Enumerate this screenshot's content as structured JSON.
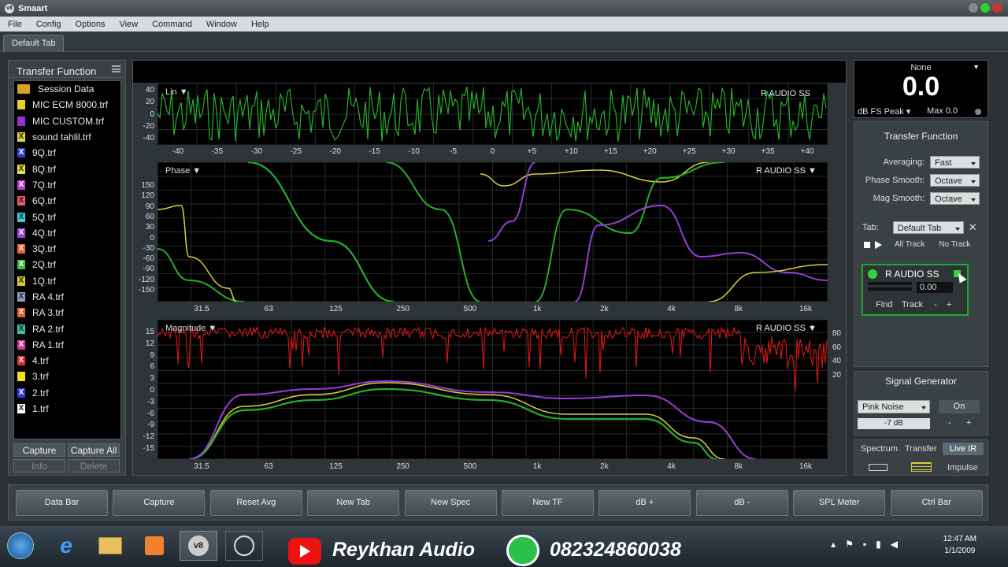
{
  "app": {
    "title": "Smaart",
    "logo": "v8"
  },
  "menu": [
    "File",
    "Config",
    "Options",
    "View",
    "Command",
    "Window",
    "Help"
  ],
  "tab": "Default Tab",
  "left_panel": {
    "title": "Transfer Function",
    "session": "Session Data",
    "files": [
      {
        "name": "MIC ECM 8000.trf",
        "color": "#e6d21c",
        "mark": ""
      },
      {
        "name": "MIC CUSTOM.trf",
        "color": "#9b2fd6",
        "mark": ""
      },
      {
        "name": "sound tahlil.trf",
        "color": "#dfd43a",
        "mark": "X"
      },
      {
        "name": "9Q.trf",
        "color": "#2c3fd8",
        "mark": "X"
      },
      {
        "name": "8Q.trf",
        "color": "#e8e03a",
        "mark": "X"
      },
      {
        "name": "7Q.trf",
        "color": "#c03ad8",
        "mark": "X"
      },
      {
        "name": "6Q.trf",
        "color": "#e85a6a",
        "mark": "X"
      },
      {
        "name": "5Q.trf",
        "color": "#3ad0d8",
        "mark": "X"
      },
      {
        "name": "4Q.trf",
        "color": "#a040e0",
        "mark": "X"
      },
      {
        "name": "3Q.trf",
        "color": "#e8602a",
        "mark": "X"
      },
      {
        "name": "2Q.trf",
        "color": "#3ac040",
        "mark": "X"
      },
      {
        "name": "1Q.trf",
        "color": "#d8d020",
        "mark": "X"
      },
      {
        "name": "RA 4.trf",
        "color": "#8aa0c8",
        "mark": "X"
      },
      {
        "name": "RA 3.trf",
        "color": "#e8602a",
        "mark": "X"
      },
      {
        "name": "RA 2.trf",
        "color": "#3ac0a0",
        "mark": "X"
      },
      {
        "name": "RA 1.trf",
        "color": "#e030a0",
        "mark": "X"
      },
      {
        "name": "4.trf",
        "color": "#e02a2a",
        "mark": "X"
      },
      {
        "name": "3.trf",
        "color": "#f0e020",
        "mark": ""
      },
      {
        "name": "2.trf",
        "color": "#2a3ae0",
        "mark": "X"
      },
      {
        "name": "1.trf",
        "color": "#ffffff",
        "mark": "X"
      }
    ],
    "buttons": [
      "Capture",
      "Capture All",
      "Info",
      "Delete"
    ]
  },
  "plots": {
    "ir": {
      "title": "Lin",
      "name": "R AUDIO SS",
      "yticks": [
        "40",
        "20",
        "0",
        "-20",
        "-40"
      ],
      "xticks": [
        "-40",
        "-35",
        "-30",
        "-25",
        "-20",
        "-15",
        "-10",
        "-5",
        "0",
        "+5",
        "+10",
        "+15",
        "+20",
        "+25",
        "+30",
        "+35",
        "+40"
      ]
    },
    "phase": {
      "title": "Phase",
      "name": "R AUDIO SS",
      "yticks": [
        "150",
        "120",
        "90",
        "60",
        "30",
        "0",
        "-30",
        "-60",
        "-90",
        "-120",
        "-150"
      ]
    },
    "magnitude": {
      "title": "Magnitude",
      "name": "R AUDIO SS",
      "yticks": [
        "15",
        "12",
        "9",
        "6",
        "3",
        "0",
        "-3",
        "-6",
        "-9",
        "-12",
        "-15"
      ],
      "yticks_right": [
        "80",
        "60",
        "40",
        "20"
      ]
    },
    "freq_ticks": [
      "31.5",
      "63",
      "125",
      "250",
      "500",
      "1k",
      "2k",
      "4k",
      "8k",
      "16k"
    ]
  },
  "meter": {
    "source": "None",
    "value": "0.0",
    "unit": "dB FS Peak",
    "max": "Max 0.0"
  },
  "transfer_panel": {
    "title": "Transfer Function",
    "averaging_label": "Averaging:",
    "averaging": "Fast",
    "phase_smooth_label": "Phase Smooth:",
    "phase_smooth": "Octave",
    "mag_smooth_label": "Mag Smooth:",
    "mag_smooth": "Octave",
    "tab_label": "Tab:",
    "tab_value": "Default Tab",
    "all_track": "All Track",
    "no_track": "No Track",
    "channel": {
      "name": "R AUDIO SS",
      "delay": "0.00",
      "find": "Find",
      "track": "Track",
      "minus": "-",
      "plus": "+"
    }
  },
  "signal_generator": {
    "title": "Signal Generator",
    "type": "Pink Noise",
    "on": "On",
    "level": "-7 dB",
    "minus": "-",
    "plus": "+"
  },
  "modes": {
    "spectrum": "Spectrum",
    "transfer": "Transfer",
    "live_ir": "Live IR",
    "impulse": "Impulse"
  },
  "command_bar": [
    "Data Bar",
    "Capture",
    "Reset Avg",
    "New Tab",
    "New Spec",
    "New TF",
    "dB +",
    "dB -",
    "SPL Meter",
    "Ctrl Bar"
  ],
  "overlay": {
    "brand": "Reykhan Audio",
    "phone": "082324860038"
  },
  "clock": {
    "time": "12:47 AM",
    "date": "1/1/2009"
  }
}
